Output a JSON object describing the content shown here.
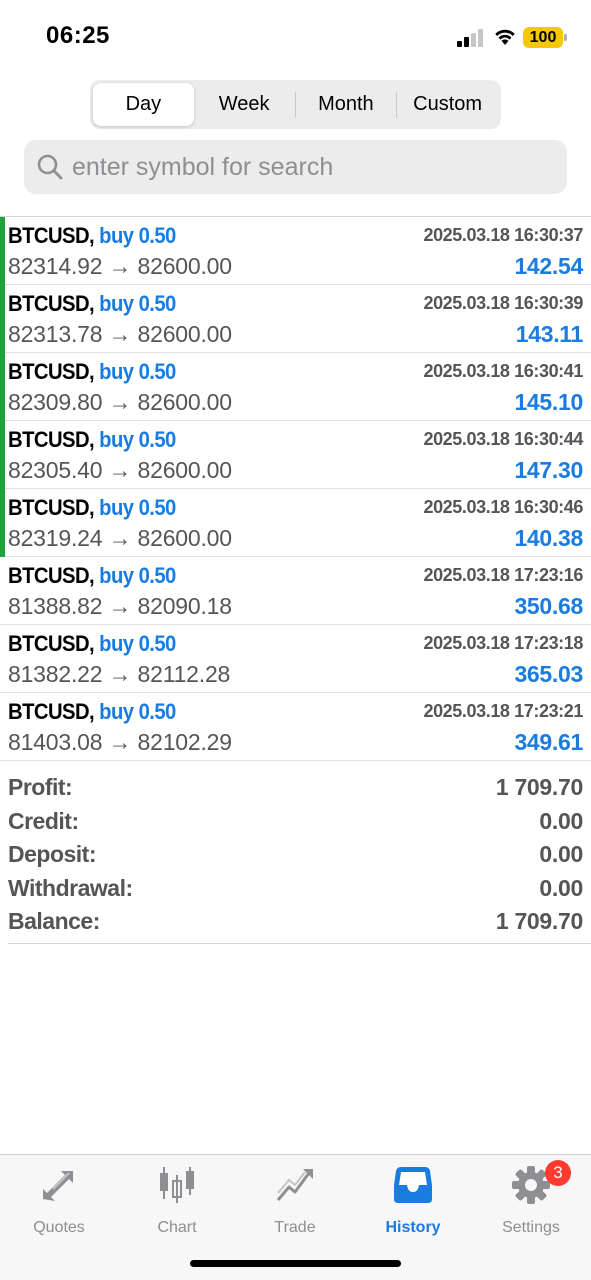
{
  "status_bar": {
    "time": "06:25",
    "battery": "100",
    "battery_color": "#f5c800"
  },
  "period_tabs": [
    {
      "label": "Day",
      "active": true
    },
    {
      "label": "Week",
      "active": false
    },
    {
      "label": "Month",
      "active": false
    },
    {
      "label": "Custom",
      "active": false
    }
  ],
  "search": {
    "placeholder": "enter symbol for search",
    "value": ""
  },
  "deals": [
    {
      "symbol": "BTCUSD,",
      "type": "buy 0.50",
      "time": "2025.03.18 16:30:37",
      "prices": "82314.92 → 82600.00",
      "profit": "142.54",
      "marker": true
    },
    {
      "symbol": "BTCUSD,",
      "type": "buy 0.50",
      "time": "2025.03.18 16:30:39",
      "prices": "82313.78 → 82600.00",
      "profit": "143.11",
      "marker": true
    },
    {
      "symbol": "BTCUSD,",
      "type": "buy 0.50",
      "time": "2025.03.18 16:30:41",
      "prices": "82309.80 → 82600.00",
      "profit": "145.10",
      "marker": true
    },
    {
      "symbol": "BTCUSD,",
      "type": "buy 0.50",
      "time": "2025.03.18 16:30:44",
      "prices": "82305.40 → 82600.00",
      "profit": "147.30",
      "marker": true
    },
    {
      "symbol": "BTCUSD,",
      "type": "buy 0.50",
      "time": "2025.03.18 16:30:46",
      "prices": "82319.24 → 82600.00",
      "profit": "140.38",
      "marker": true
    },
    {
      "symbol": "BTCUSD,",
      "type": "buy 0.50",
      "time": "2025.03.18 17:23:16",
      "prices": "81388.82 → 82090.18",
      "profit": "350.68",
      "marker": false
    },
    {
      "symbol": "BTCUSD,",
      "type": "buy 0.50",
      "time": "2025.03.18 17:23:18",
      "prices": "81382.22 → 82112.28",
      "profit": "365.03",
      "marker": false
    },
    {
      "symbol": "BTCUSD,",
      "type": "buy 0.50",
      "time": "2025.03.18 17:23:21",
      "prices": "81403.08 → 82102.29",
      "profit": "349.61",
      "marker": false
    }
  ],
  "summary": [
    {
      "label": "Profit:",
      "value": "1 709.70"
    },
    {
      "label": "Credit:",
      "value": "0.00"
    },
    {
      "label": "Deposit:",
      "value": "0.00"
    },
    {
      "label": "Withdrawal:",
      "value": "0.00"
    },
    {
      "label": "Balance:",
      "value": "1 709.70"
    }
  ],
  "tabbar": {
    "quotes": {
      "label": "Quotes",
      "icon": "quotes-arrows-icon"
    },
    "chart": {
      "label": "Chart",
      "icon": "candlestick-icon"
    },
    "trade": {
      "label": "Trade",
      "icon": "trade-trend-icon"
    },
    "history": {
      "label": "History",
      "icon": "inbox-tray-icon",
      "active": true
    },
    "settings": {
      "label": "Settings",
      "icon": "gear-icon",
      "badge": "3"
    }
  },
  "colors": {
    "accent": "#1a7be0",
    "marker_green": "#1fa337",
    "badge_red": "#ff3b30",
    "muted": "#8e8e93"
  }
}
